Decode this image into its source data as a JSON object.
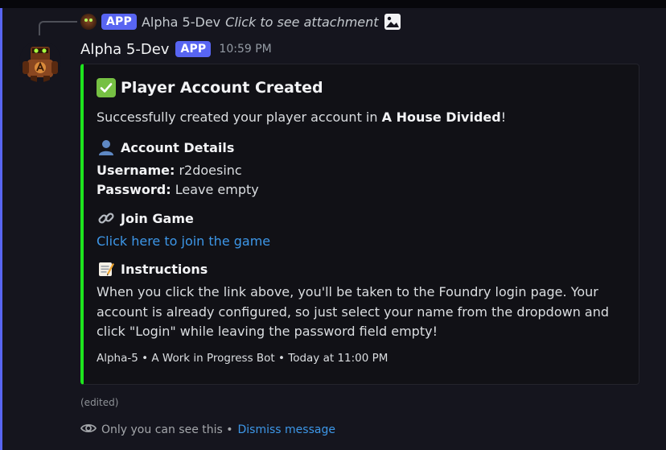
{
  "reply": {
    "app_tag": "APP",
    "author": "Alpha 5-Dev",
    "text": "Click to see attachment",
    "attachment_icon": "image-icon"
  },
  "message": {
    "author": "Alpha 5-Dev",
    "app_tag": "APP",
    "timestamp": "10:59 PM",
    "avatar_icon": "robot-avatar"
  },
  "embed": {
    "accent_color": "#1ee51e",
    "title": "Player Account Created",
    "title_icon": "check-mark-icon",
    "description_prefix": "Successfully created your player account in ",
    "description_bold": "A House Divided",
    "description_suffix": "!",
    "account_section": {
      "icon": "user-silhouette-icon",
      "title": "Account Details",
      "username_label": "Username:",
      "username_value": " r2doesinc",
      "password_label": "Password:",
      "password_value": " Leave empty"
    },
    "join_section": {
      "icon": "link-icon",
      "title": "Join Game",
      "link_text": "Click here to join the game"
    },
    "instructions_section": {
      "icon": "memo-icon",
      "title": "Instructions",
      "body": "When you click the link above, you'll be taken to the Foundry login page. Your account is already configured, so just select your name from the dropdown and click \"Login\" while leaving the password field empty!"
    },
    "footer": "Alpha-5 • A Work in Progress Bot • Today at 11:00 PM"
  },
  "edited_label": "(edited)",
  "ephemeral": {
    "icon": "eye-icon",
    "text": "Only you can see this •",
    "dismiss_label": "Dismiss message"
  },
  "colors": {
    "brand": "#5865f2",
    "link": "#3d97e8",
    "embed_accent": "#1ee51e"
  }
}
